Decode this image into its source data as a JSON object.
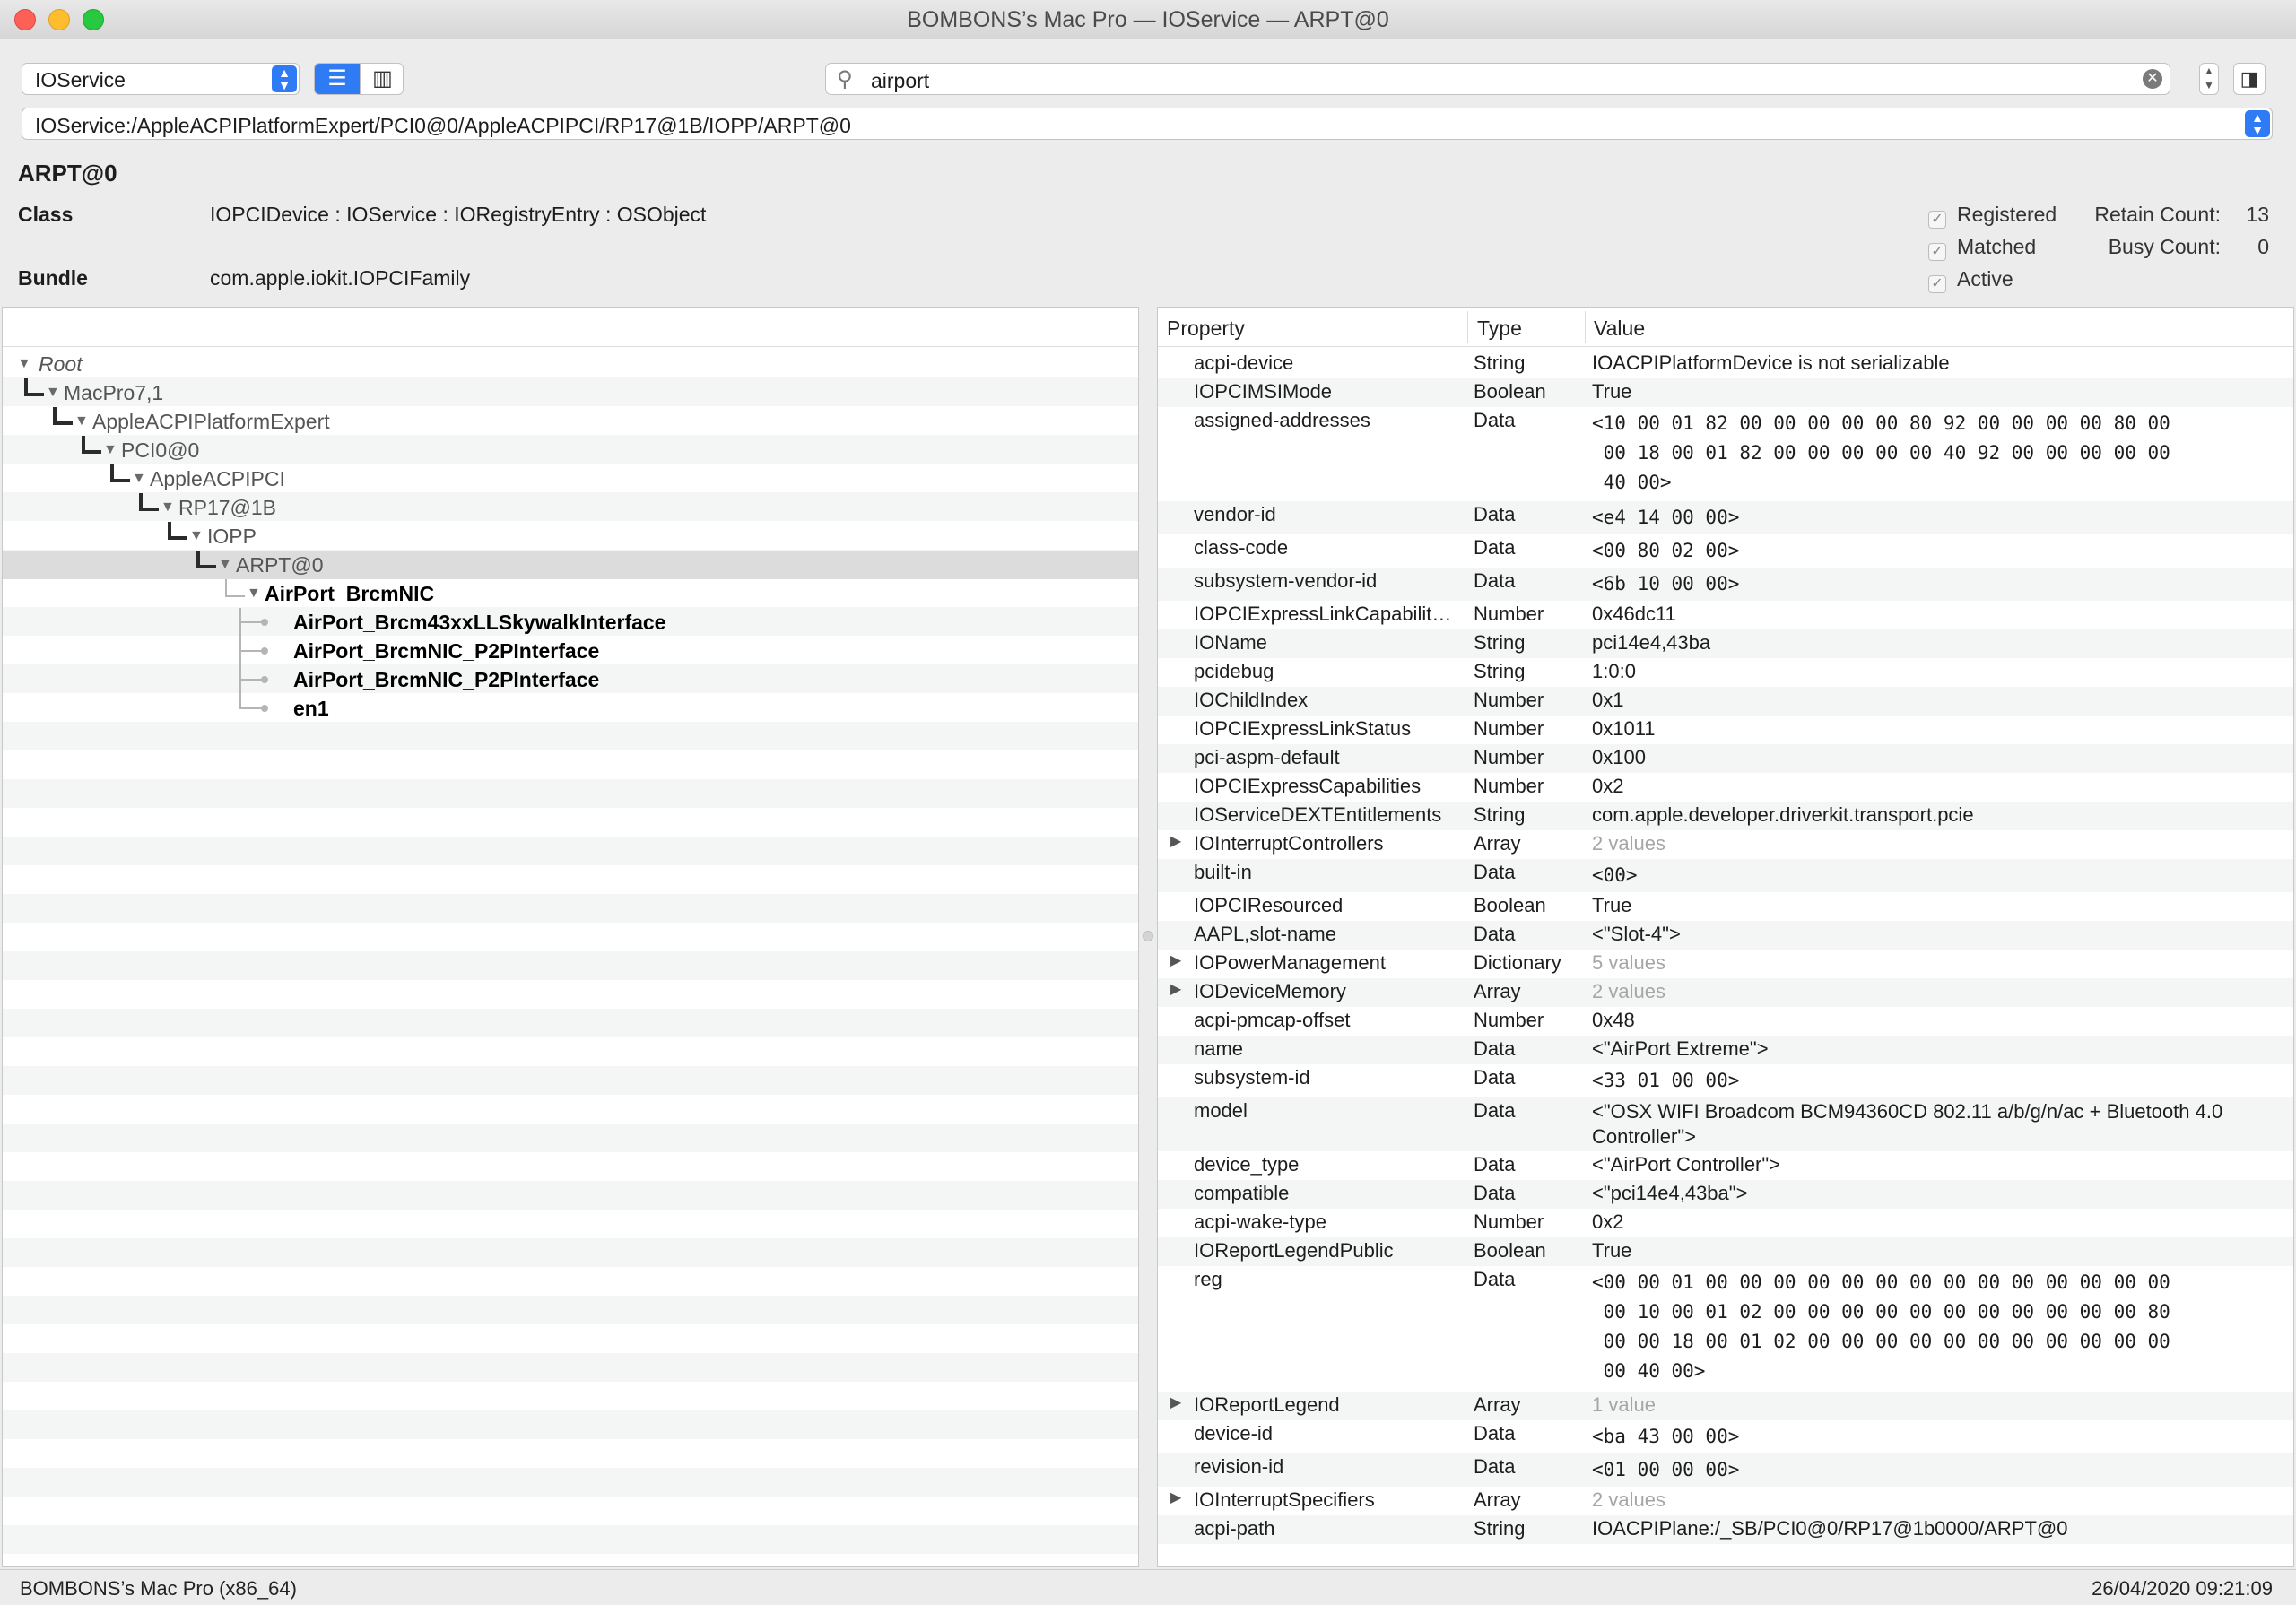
{
  "window": {
    "title": "BOMBONS’s Mac Pro — IOService — ARPT@0"
  },
  "toolbar": {
    "plane": "IOService",
    "search_value": "airport",
    "path": "IOService:/AppleACPIPlatformExpert/PCI0@0/AppleACPIPCI/RP17@1B/IOPP/ARPT@0"
  },
  "info": {
    "name": "ARPT@0",
    "class_label": "Class",
    "class_value": "IOPCIDevice : IOService : IORegistryEntry : OSObject",
    "bundle_label": "Bundle",
    "bundle_value": "com.apple.iokit.IOPCIFamily",
    "registered": "Registered",
    "matched": "Matched",
    "active": "Active",
    "retain_label": "Retain Count:",
    "retain_value": "13",
    "busy_label": "Busy Count:",
    "busy_value": "0"
  },
  "tree": [
    {
      "label": "Root"
    },
    {
      "label": "MacPro7,1"
    },
    {
      "label": "AppleACPIPlatformExpert"
    },
    {
      "label": "PCI0@0"
    },
    {
      "label": "AppleACPIPCI"
    },
    {
      "label": "RP17@1B"
    },
    {
      "label": "IOPP"
    },
    {
      "label": "ARPT@0"
    },
    {
      "label": "AirPort_BrcmNIC"
    },
    {
      "label": "AirPort_Brcm43xxLLSkywalkInterface"
    },
    {
      "label": "AirPort_BrcmNIC_P2PInterface"
    },
    {
      "label": "AirPort_BrcmNIC_P2PInterface"
    },
    {
      "label": "en1"
    }
  ],
  "props_header": {
    "property": "Property",
    "type": "Type",
    "value": "Value"
  },
  "props": [
    {
      "p": "acpi-device",
      "t": "String",
      "v": "IOACPIPlatformDevice is not serializable"
    },
    {
      "p": "IOPCIMSIMode",
      "t": "Boolean",
      "v": "True"
    },
    {
      "p": "assigned-addresses",
      "t": "Data",
      "v": "<10 00 01 82 00 00 00 00 00 80 92 00 00 00 00 80 00\n 00 18 00 01 82 00 00 00 00 00 40 92 00 00 00 00 00\n 40 00>"
    },
    {
      "p": "vendor-id",
      "t": "Data",
      "v": "<e4 14 00 00>"
    },
    {
      "p": "class-code",
      "t": "Data",
      "v": "<00 80 02 00>"
    },
    {
      "p": "subsystem-vendor-id",
      "t": "Data",
      "v": "<6b 10 00 00>"
    },
    {
      "p": "IOPCIExpressLinkCapabilit…",
      "t": "Number",
      "v": "0x46dc11"
    },
    {
      "p": "IOName",
      "t": "String",
      "v": "pci14e4,43ba"
    },
    {
      "p": "pcidebug",
      "t": "String",
      "v": "1:0:0"
    },
    {
      "p": "IOChildIndex",
      "t": "Number",
      "v": "0x1"
    },
    {
      "p": "IOPCIExpressLinkStatus",
      "t": "Number",
      "v": "0x1011"
    },
    {
      "p": "pci-aspm-default",
      "t": "Number",
      "v": "0x100"
    },
    {
      "p": "IOPCIExpressCapabilities",
      "t": "Number",
      "v": "0x2"
    },
    {
      "p": "IOServiceDEXTEntitlements",
      "t": "String",
      "v": "com.apple.developer.driverkit.transport.pcie"
    },
    {
      "p": "IOInterruptControllers",
      "t": "Array",
      "v": "2 values"
    },
    {
      "p": "built-in",
      "t": "Data",
      "v": "<00>"
    },
    {
      "p": "IOPCIResourced",
      "t": "Boolean",
      "v": "True"
    },
    {
      "p": "AAPL,slot-name",
      "t": "Data",
      "v": "<\"Slot-4\">"
    },
    {
      "p": "IOPowerManagement",
      "t": "Dictionary",
      "v": "5 values"
    },
    {
      "p": "IODeviceMemory",
      "t": "Array",
      "v": "2 values"
    },
    {
      "p": "acpi-pmcap-offset",
      "t": "Number",
      "v": "0x48"
    },
    {
      "p": "name",
      "t": "Data",
      "v": "<\"AirPort Extreme\">"
    },
    {
      "p": "subsystem-id",
      "t": "Data",
      "v": "<33 01 00 00>"
    },
    {
      "p": "model",
      "t": "Data",
      "v": "<\"OSX WIFI Broadcom BCM94360CD 802.11 a/b/g/n/ac + Bluetooth 4.0 Controller\">"
    },
    {
      "p": "device_type",
      "t": "Data",
      "v": "<\"AirPort Controller\">"
    },
    {
      "p": "compatible",
      "t": "Data",
      "v": "<\"pci14e4,43ba\">"
    },
    {
      "p": "acpi-wake-type",
      "t": "Number",
      "v": "0x2"
    },
    {
      "p": "IOReportLegendPublic",
      "t": "Boolean",
      "v": "True"
    },
    {
      "p": "reg",
      "t": "Data",
      "v": "<00 00 01 00 00 00 00 00 00 00 00 00 00 00 00 00 00\n 00 10 00 01 02 00 00 00 00 00 00 00 00 00 00 00 80\n 00 00 18 00 01 02 00 00 00 00 00 00 00 00 00 00 00\n 00 40 00>"
    },
    {
      "p": "IOReportLegend",
      "t": "Array",
      "v": "1 value"
    },
    {
      "p": "device-id",
      "t": "Data",
      "v": "<ba 43 00 00>"
    },
    {
      "p": "revision-id",
      "t": "Data",
      "v": "<01 00 00 00>"
    },
    {
      "p": "IOInterruptSpecifiers",
      "t": "Array",
      "v": "2 values"
    },
    {
      "p": "acpi-path",
      "t": "String",
      "v": "IOACPIPlane:/_SB/PCI0@0/RP17@1b0000/ARPT@0"
    }
  ],
  "status": {
    "machine": "BOMBONS’s Mac Pro (x86_64)",
    "datetime": "26/04/2020 09:21:09"
  }
}
